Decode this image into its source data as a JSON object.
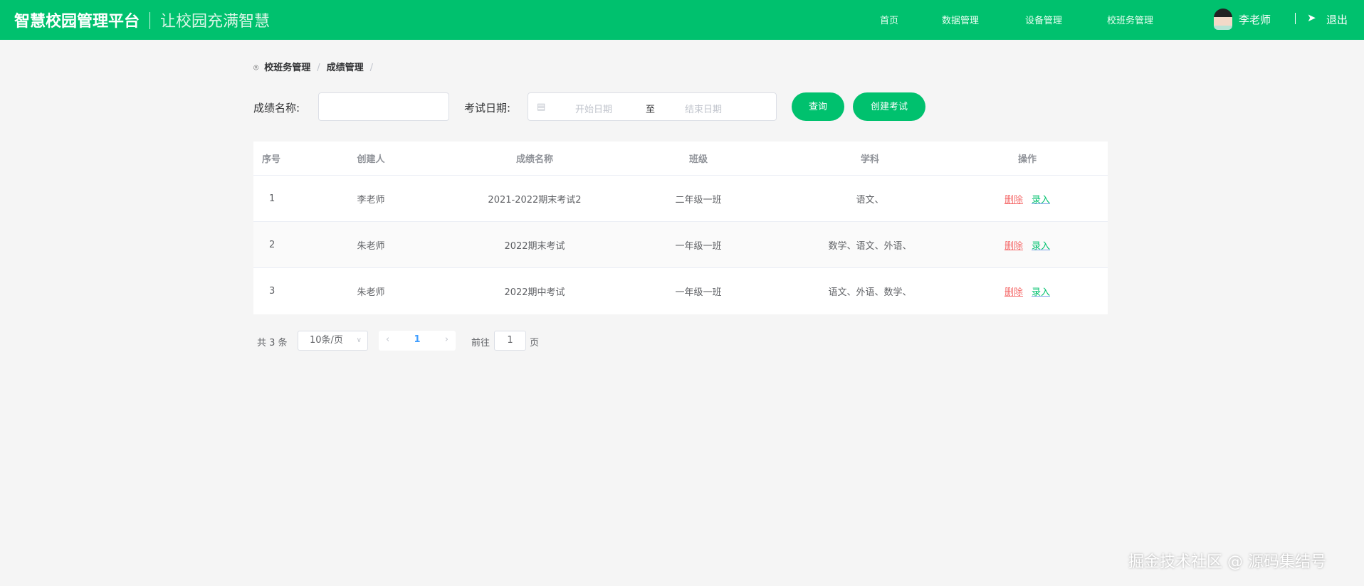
{
  "header": {
    "title": "智慧校园管理平台",
    "slogan": "让校园充满智慧",
    "nav": [
      "首页",
      "数据管理",
      "设备管理",
      "校班务管理"
    ],
    "user": "李老师",
    "logout": "退出"
  },
  "breadcrumb": [
    "校班务管理",
    "成绩管理"
  ],
  "filters": {
    "name_label": "成绩名称:",
    "name_value": "",
    "date_label": "考试日期:",
    "start_placeholder": "开始日期",
    "range_sep": "至",
    "end_placeholder": "结束日期",
    "search": "查询",
    "create": "创建考试"
  },
  "table": {
    "headers": [
      "序号",
      "创建人",
      "成绩名称",
      "班级",
      "学科",
      "操作"
    ],
    "rows": [
      {
        "no": "1",
        "creator": "李老师",
        "name": "2021-2022期末考试2",
        "class": "二年级一班",
        "subjects": "语文、"
      },
      {
        "no": "2",
        "creator": "朱老师",
        "name": "2022期末考试",
        "class": "一年级一班",
        "subjects": "数学、语文、外语、"
      },
      {
        "no": "3",
        "creator": "朱老师",
        "name": "2022期中考试",
        "class": "一年级一班",
        "subjects": "语文、外语、数学、"
      }
    ],
    "delete": "删除",
    "record": "录入"
  },
  "pagination": {
    "total": "共 3 条",
    "page_size": "10条/页",
    "current": "1",
    "goto_label": "前往",
    "goto_value": "1",
    "page_suffix": "页"
  },
  "watermark": "掘金技术社区 @ 源码集结号"
}
